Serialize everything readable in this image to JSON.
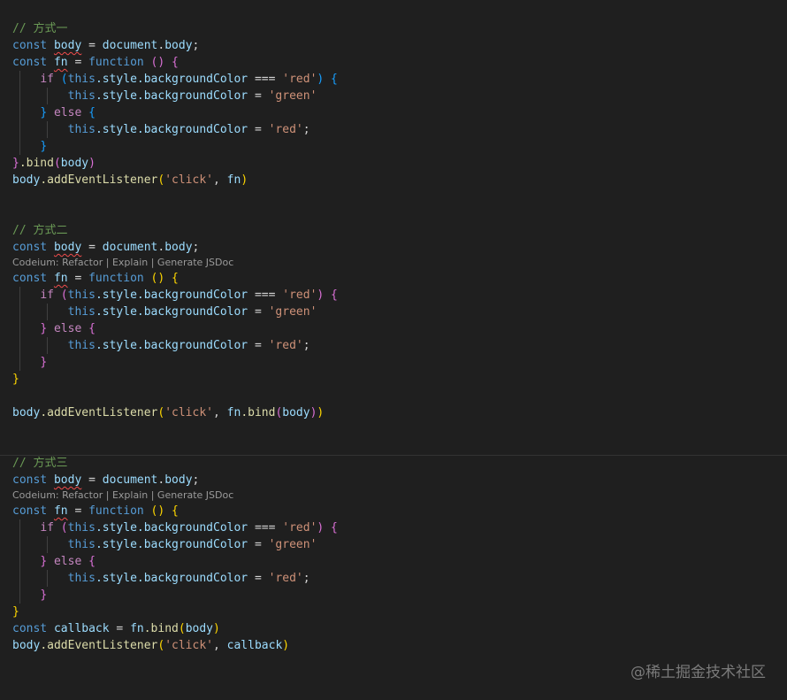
{
  "block1": {
    "comment": "// 方式一",
    "decl_kw": "const",
    "decl_name": "body",
    "decl_eq": " = ",
    "decl_obj": "document",
    "decl_dot": ".",
    "decl_prop": "body",
    "decl_semi": ";",
    "fn_kw": "const",
    "fn_name": "fn",
    "fn_eq": " = ",
    "fn_function": "function",
    "fn_parens": " () ",
    "fn_open": "{",
    "if_kw": "if",
    "if_open": " (",
    "if_this": "this",
    "if_chain": ".style.backgroundColor",
    "if_op": " === ",
    "if_str": "'red'",
    "if_close": ")",
    "if_brace": " {",
    "then_this": "this",
    "then_chain": ".style.backgroundColor",
    "then_op": " = ",
    "then_str": "'green'",
    "else_close": "}",
    "else_kw": " else ",
    "else_open": "{",
    "else_this": "this",
    "else_chain": ".style.backgroundColor",
    "else_op": " = ",
    "else_str": "'red'",
    "else_semi": ";",
    "inner_close": "}",
    "end_close": "}",
    "end_bind": ".bind",
    "end_paren_open": "(",
    "end_arg": "body",
    "end_paren_close": ")",
    "listen_obj": "body",
    "listen_method": ".addEventListener",
    "listen_open": "(",
    "listen_str": "'click'",
    "listen_comma": ", ",
    "listen_arg": "fn",
    "listen_close": ")"
  },
  "block2": {
    "comment": "// 方式二",
    "decl_kw": "const",
    "decl_name": "body",
    "decl_eq": " = ",
    "decl_obj": "document",
    "decl_dot": ".",
    "decl_prop": "body",
    "decl_semi": ";",
    "codelens": "Codeium: Refactor | Explain | Generate JSDoc",
    "fn_kw": "const",
    "fn_name": "fn",
    "fn_eq": " = ",
    "fn_function": "function",
    "fn_parens": " () ",
    "fn_open": "{",
    "if_kw": "if",
    "if_open": " (",
    "if_this": "this",
    "if_chain": ".style.backgroundColor",
    "if_op": " === ",
    "if_str": "'red'",
    "if_close": ")",
    "if_brace": " {",
    "then_this": "this",
    "then_chain": ".style.backgroundColor",
    "then_op": " = ",
    "then_str": "'green'",
    "else_close": "}",
    "else_kw": " else ",
    "else_open": "{",
    "else_this": "this",
    "else_chain": ".style.backgroundColor",
    "else_op": " = ",
    "else_str": "'red'",
    "else_semi": ";",
    "inner_close": "}",
    "end_close": "}",
    "listen_obj": "body",
    "listen_method": ".addEventListener",
    "listen_open": "(",
    "listen_str": "'click'",
    "listen_comma": ", ",
    "listen_fn": "fn",
    "listen_bind": ".bind",
    "listen_bopen": "(",
    "listen_arg": "body",
    "listen_bclose": ")",
    "listen_close": ")"
  },
  "block3": {
    "comment": "// 方式三",
    "decl_kw": "const",
    "decl_name": "body",
    "decl_eq": " = ",
    "decl_obj": "document",
    "decl_dot": ".",
    "decl_prop": "body",
    "decl_semi": ";",
    "codelens": "Codeium: Refactor | Explain | Generate JSDoc",
    "fn_kw": "const",
    "fn_name": "fn",
    "fn_eq": " = ",
    "fn_function": "function",
    "fn_parens": " () ",
    "fn_open": "{",
    "if_kw": "if",
    "if_open": " (",
    "if_this": "this",
    "if_chain": ".style.backgroundColor",
    "if_op": " === ",
    "if_str": "'red'",
    "if_close": ")",
    "if_brace": " {",
    "then_this": "this",
    "then_chain": ".style.backgroundColor",
    "then_op": " = ",
    "then_str": "'green'",
    "else_close": "}",
    "else_kw": " else ",
    "else_open": "{",
    "else_this": "this",
    "else_chain": ".style.backgroundColor",
    "else_op": " = ",
    "else_str": "'red'",
    "else_semi": ";",
    "inner_close": "}",
    "end_close": "}",
    "cb_kw": "const",
    "cb_name": "callback",
    "cb_eq": " = ",
    "cb_fn": "fn",
    "cb_bind": ".bind",
    "cb_open": "(",
    "cb_arg": "body",
    "cb_close": ")",
    "listen_obj": "body",
    "listen_method": ".addEventListener",
    "listen_open": "(",
    "listen_str": "'click'",
    "listen_comma": ", ",
    "listen_arg": "callback",
    "listen_close": ")"
  },
  "watermark": "@稀土掘金技术社区",
  "colors": {
    "background": "#1f1f1f",
    "comment": "#6a9955",
    "keyword": "#569cd6",
    "control": "#c586c0",
    "variable": "#9cdcfe",
    "function": "#dcdcaa",
    "string": "#ce9178",
    "bracket_1": "#ffd700",
    "bracket_2": "#da70d6",
    "bracket_3": "#179fff",
    "squiggle": "#f14c4c"
  }
}
